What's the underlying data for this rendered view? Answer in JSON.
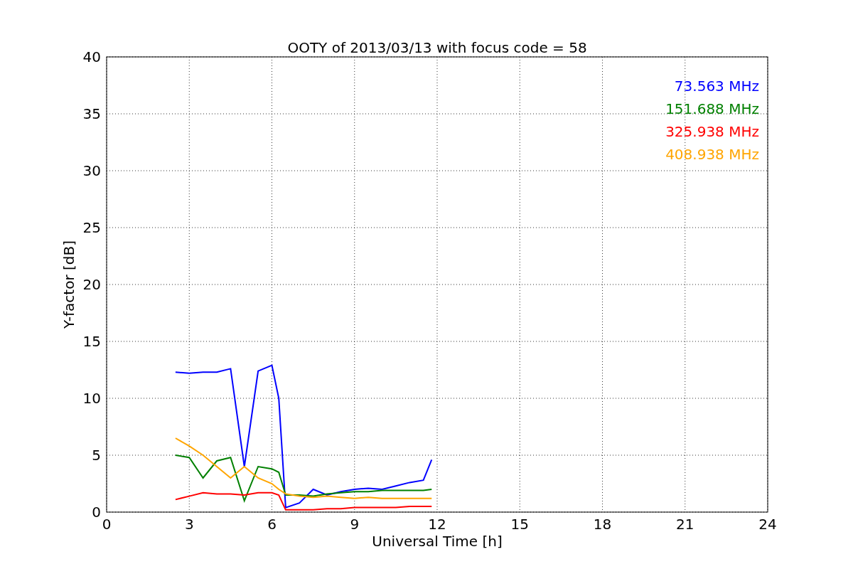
{
  "chart": {
    "chart_data": {
      "type": "line",
      "title": "OOTY of 2013/03/13 with focus code = 58",
      "xlabel": "Universal Time [h]",
      "ylabel": "Y-factor [dB]",
      "x": [
        2.5,
        3,
        3.5,
        4,
        4.5,
        5,
        5.5,
        6,
        6.25,
        6.5,
        7,
        7.5,
        8,
        8.5,
        9,
        9.5,
        10,
        10.5,
        11,
        11.5,
        11.8
      ],
      "series": [
        {
          "name": "73.563 MHz",
          "color": "#0000ff",
          "values": [
            12.3,
            12.2,
            12.3,
            12.3,
            12.6,
            4,
            12.4,
            12.9,
            10,
            0.4,
            0.8,
            2,
            1.5,
            1.8,
            2,
            2.1,
            2,
            2.3,
            2.6,
            2.8,
            4.6
          ]
        },
        {
          "name": "151.688 MHz",
          "color": "#008000",
          "values": [
            5,
            4.8,
            3,
            4.5,
            4.8,
            1,
            4,
            3.8,
            3.5,
            1.5,
            1.5,
            1.4,
            1.6,
            1.7,
            1.8,
            1.8,
            1.9,
            1.9,
            1.9,
            1.9,
            2
          ]
        },
        {
          "name": "325.938 MHz",
          "color": "#ff0000",
          "values": [
            1.1,
            1.4,
            1.7,
            1.6,
            1.6,
            1.5,
            1.7,
            1.7,
            1.5,
            0.2,
            0.2,
            0.2,
            0.3,
            0.3,
            0.4,
            0.4,
            0.4,
            0.4,
            0.5,
            0.5,
            0.5
          ]
        },
        {
          "name": "408.938 MHz",
          "color": "#ffa500",
          "values": [
            6.5,
            5.8,
            5,
            4,
            3,
            4,
            3,
            2.5,
            2,
            1.6,
            1.4,
            1.3,
            1.4,
            1.3,
            1.2,
            1.3,
            1.2,
            1.2,
            1.2,
            1.2,
            1.2
          ]
        }
      ],
      "xlim": [
        0,
        24
      ],
      "ylim": [
        0,
        40
      ],
      "xticks": [
        0,
        3,
        6,
        9,
        12,
        15,
        18,
        21,
        24
      ],
      "yticks": [
        0,
        5,
        10,
        15,
        20,
        25,
        30,
        35,
        40
      ],
      "grid": true
    }
  }
}
